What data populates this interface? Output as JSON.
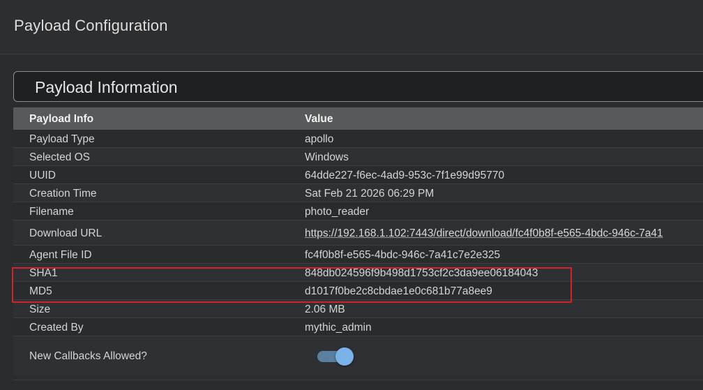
{
  "header": {
    "title": "Payload Configuration"
  },
  "section": {
    "title": "Payload Information"
  },
  "table": {
    "columns": [
      "Payload Info",
      "Value"
    ],
    "rows": [
      {
        "label": "Payload Type",
        "value": "apollo"
      },
      {
        "label": "Selected OS",
        "value": "Windows"
      },
      {
        "label": "UUID",
        "value": "64dde227-f6ec-4ad9-953c-7f1e99d95770"
      },
      {
        "label": "Creation Time",
        "value": "Sat Feb 21 2026 06:29 PM"
      },
      {
        "label": "Filename",
        "value": "photo_reader"
      },
      {
        "label": "Download URL",
        "value": "https://192.168.1.102:7443/direct/download/fc4f0b8f-e565-4bdc-946c-7a41"
      },
      {
        "label": "Agent File ID",
        "value": "fc4f0b8f-e565-4bdc-946c-7a41c7e2e325"
      },
      {
        "label": "SHA1",
        "value": "848db024596f9b498d1753cf2c3da9ee06184043"
      },
      {
        "label": "MD5",
        "value": "d1017f0be2c8cbdae1e0c681b77a8ee9"
      },
      {
        "label": "Size",
        "value": "2.06 MB"
      },
      {
        "label": "Created By",
        "value": "mythic_admin"
      },
      {
        "label": "New Callbacks Allowed?",
        "value": ""
      }
    ]
  },
  "toggle": {
    "enabled": true
  },
  "colors": {
    "highlight": "#d2232a",
    "toggle_thumb": "#7bb3e8",
    "toggle_track": "#5b7f9e"
  }
}
